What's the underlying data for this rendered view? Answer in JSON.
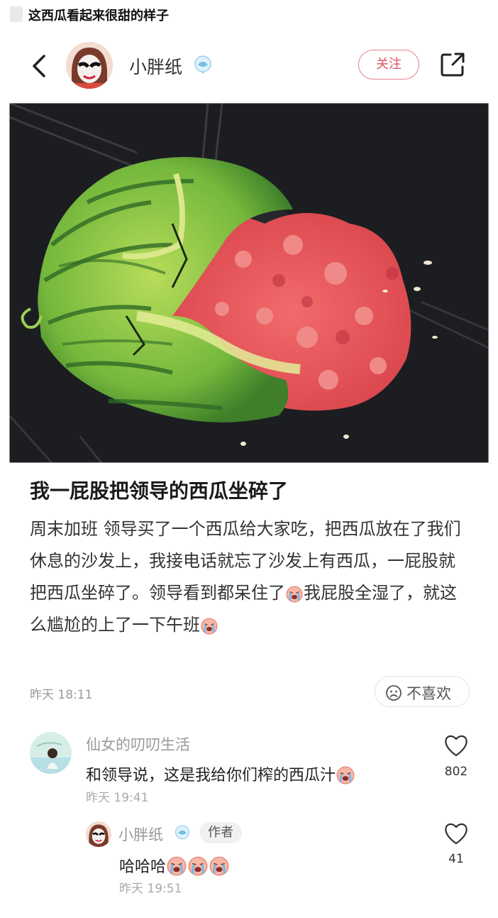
{
  "window_title": "这西瓜看起来很甜的样子",
  "header": {
    "author_name": "小胖纸",
    "follow_label": "关注"
  },
  "post": {
    "title": "我一屁股把领导的西瓜坐碎了",
    "body_1": "周末加班 领导买了一个西瓜给大家吃，把西瓜放在了我们休息的沙发上，我接电话就忘了沙发上有西瓜，一屁股就把西瓜坐碎了。领导看到都呆住了",
    "body_2": "我屁股全湿了，就这么尴尬的上了一下午班",
    "time": "昨天 18:11",
    "dislike_label": "不喜欢"
  },
  "comments": [
    {
      "user": "仙女的叨叨生活",
      "text": "和领导说，这是我给你们榨的西瓜汁",
      "time": "昨天 19:41",
      "likes": "802"
    },
    {
      "user": "小胖纸",
      "tag": "作者",
      "text": "哈哈哈",
      "time": "昨天 19:51",
      "likes": "41"
    }
  ],
  "colors": {
    "accent": "#e05364",
    "muted": "#999999",
    "photo_background": "#1c1d21"
  },
  "icons": [
    "back-arrow-icon",
    "verified-badge-icon",
    "share-icon",
    "sad-face-icon",
    "heart-icon",
    "crying-face-emoji"
  ]
}
